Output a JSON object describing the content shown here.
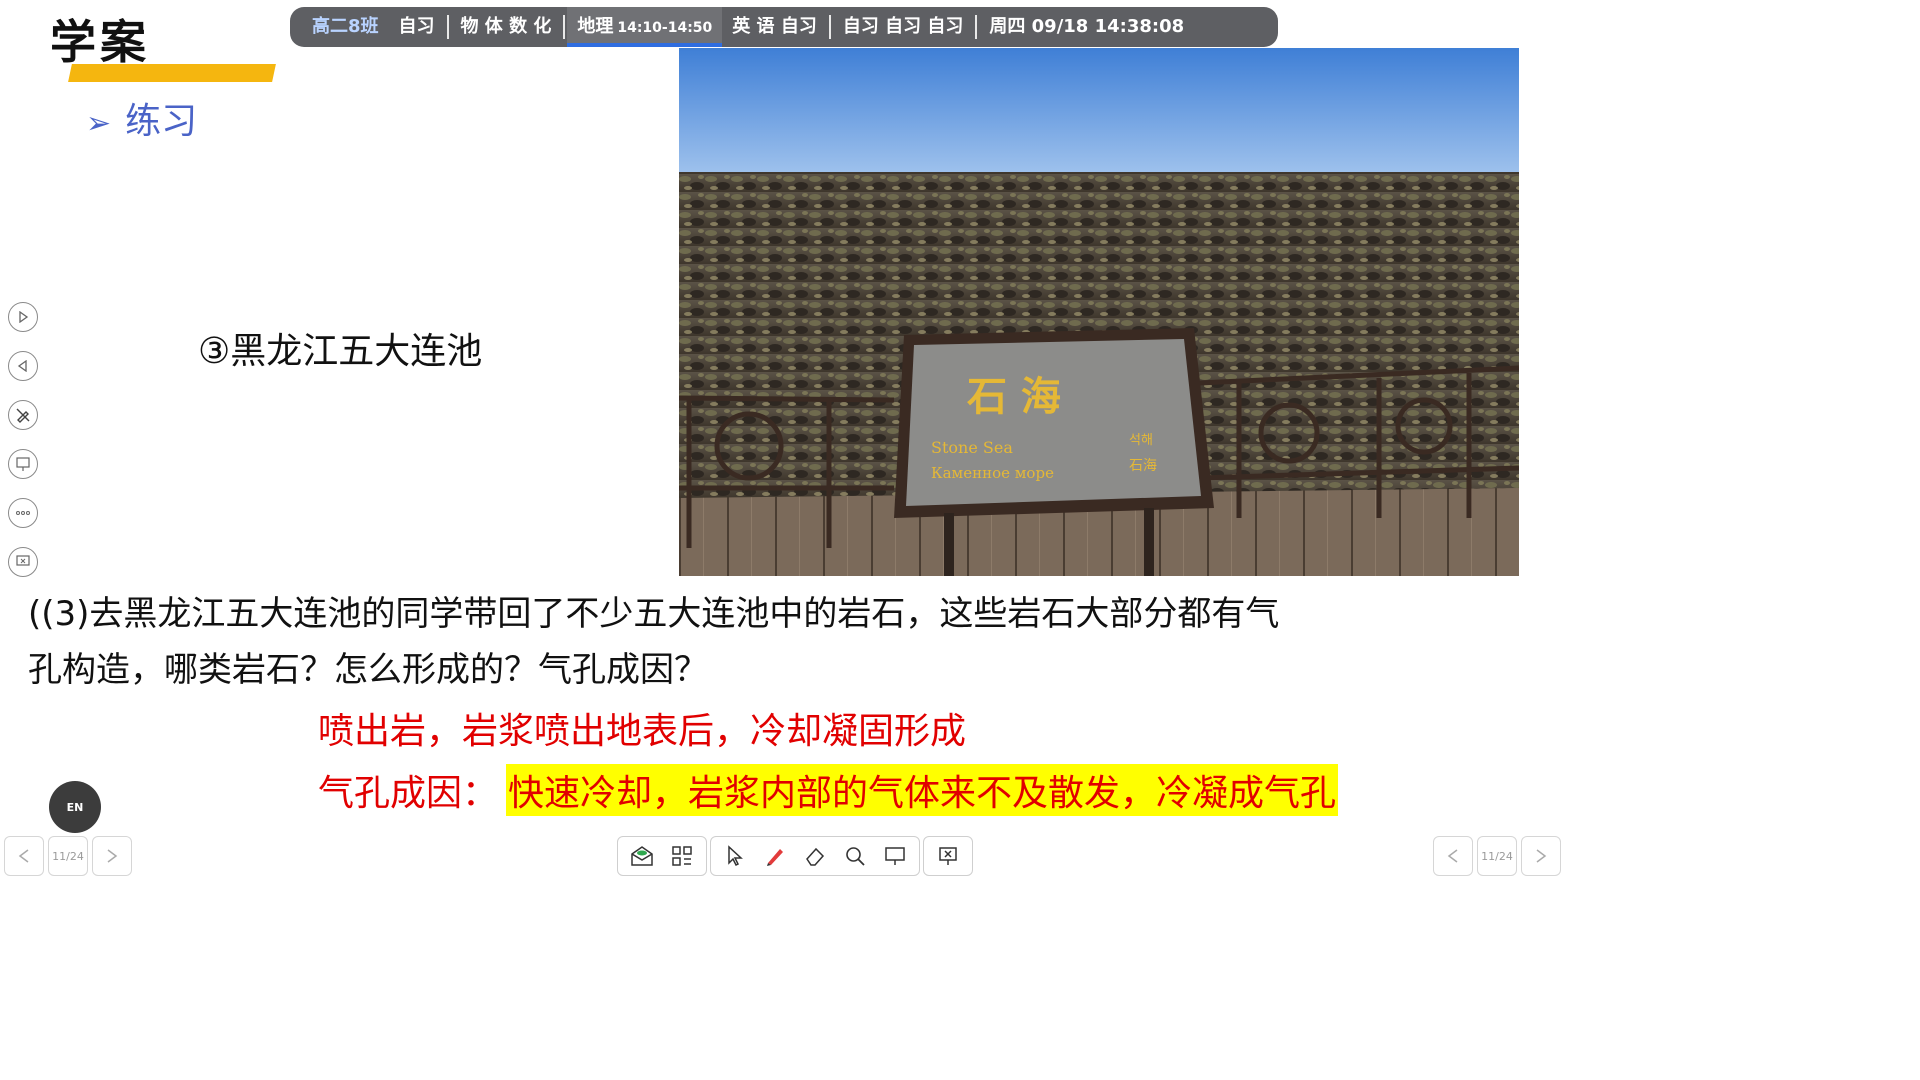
{
  "header": {
    "title": "学案",
    "section": "练习",
    "section_arrow": "➢"
  },
  "schedule": {
    "class_name": "高二8班",
    "items": [
      "自习",
      "物 体 数 化"
    ],
    "current_subject": "地理",
    "current_time": "14:10-14:50",
    "items_after": [
      "英 语 自习",
      "自习 自习 自习"
    ],
    "datetime": "周四 09/18  14:38:08"
  },
  "photo": {
    "sign_title": "石 海",
    "sign_en": "Stone Sea",
    "sign_ru": "Каменное море",
    "sign_ko": "석해",
    "sign_cn_small": "石海"
  },
  "content": {
    "place": "③黑龙江五大连池",
    "question_line1": "((3)去黑龙江五大连池的同学带回了不少五大连池中的岩石，这些岩石大部分都有气",
    "question_line2": "孔构造，哪类岩石？怎么形成的？气孔成因？",
    "answer1": "喷出岩，岩浆喷出地表后，冷却凝固形成",
    "answer2_label": "气孔成因：",
    "answer2_text": "快速冷却，岩浆内部的气体来不及散发，冷凝成气孔"
  },
  "footer": {
    "lang": "EN",
    "page_left": "11/24",
    "page_right": "11/24"
  },
  "colors": {
    "accent_title_bar": "#f5b60f",
    "section_blue": "#4a63c7",
    "answer_red": "#e10000",
    "highlight": "#ffff00",
    "schedule_bg": "#5e5f63"
  },
  "icons": {
    "left_tools": [
      "play-forward-icon",
      "play-back-icon",
      "pen-slash-icon",
      "screen-draw-icon",
      "more-icon",
      "screen-close-icon"
    ],
    "toolbar": [
      "envelope-icon",
      "apps-icon",
      "pointer-icon",
      "pen-icon",
      "eraser-icon",
      "search-icon",
      "whiteboard-icon",
      "exit-presentation-icon"
    ]
  }
}
